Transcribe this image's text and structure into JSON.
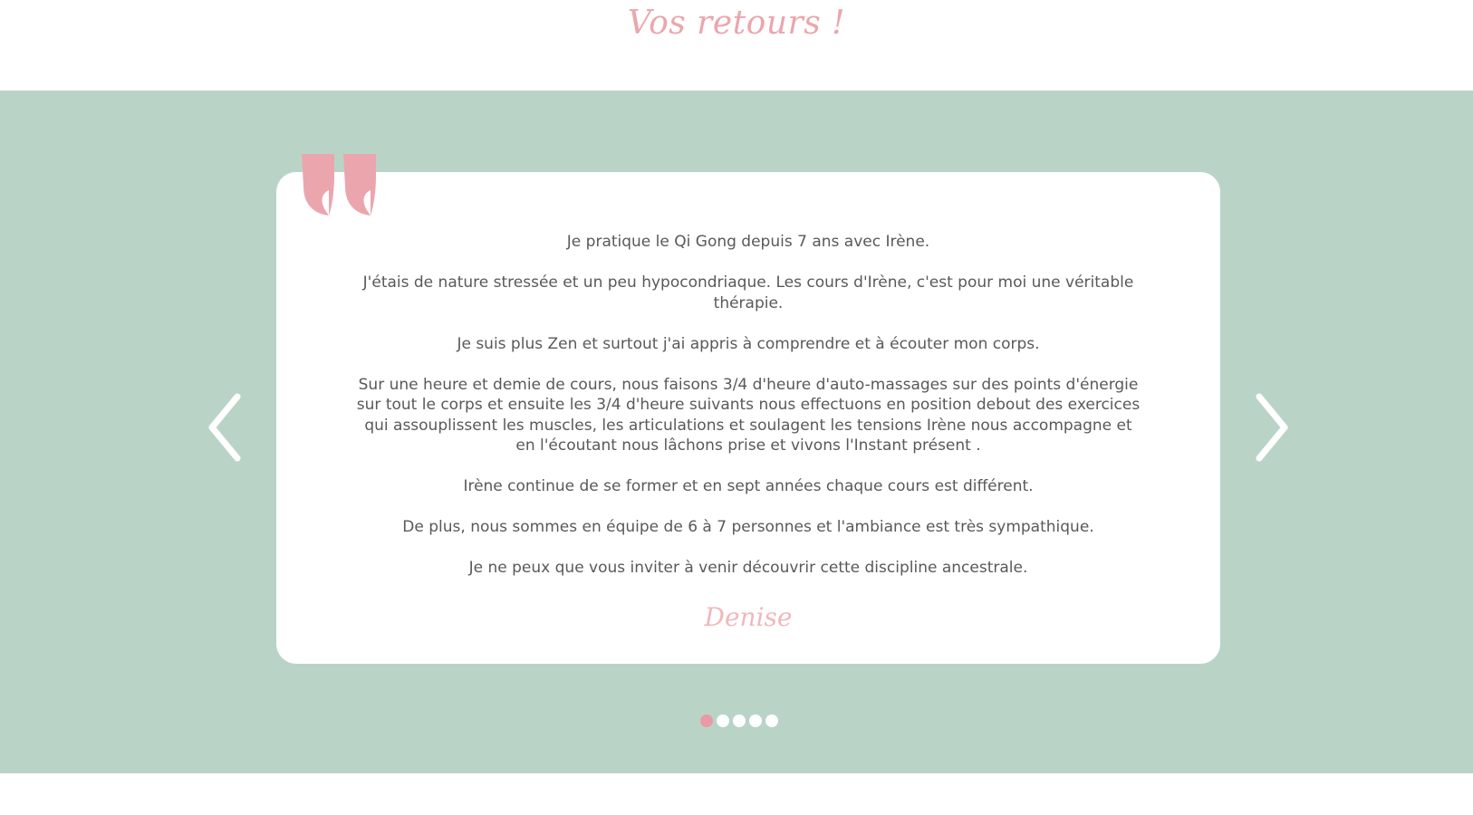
{
  "heading": "Vos retours !",
  "testimonial": {
    "paragraphs": [
      "Je pratique le Qi Gong depuis 7 ans avec Irène.",
      "J'étais de nature stressée et un peu hypocondriaque. Les cours d'Irène, c'est pour moi une véritable thérapie.",
      "Je suis plus Zen et surtout j'ai appris à comprendre et à écouter mon corps.",
      "Sur une heure et demie de cours, nous faisons 3/4 d'heure d'auto-massages sur des points d'énergie sur tout le corps et ensuite les 3/4 d'heure suivants nous effectuons en position debout des exercices qui assouplissent les muscles, les articulations et soulagent les tensions Irène nous accompagne et en l'écoutant nous lâchons prise et vivons l'Instant présent .",
      "Irène continue de se former et en sept années chaque cours est différent.",
      "De plus, nous sommes en équipe de 6 à 7 personnes et l'ambiance est très sympathique.",
      "Je ne peux que vous inviter à venir découvrir cette discipline ancestrale."
    ],
    "author": "Denise"
  },
  "icons": {
    "quote": "quote-mark-icon",
    "prev": "chevron-left-icon",
    "next": "chevron-right-icon"
  },
  "pagination": {
    "count": 5,
    "active_index": 0
  },
  "colors": {
    "band": "#b9d4c6",
    "accent_pink": "#eba6ad",
    "dot_active": "#e99aa4",
    "text": "#595959",
    "card": "#ffffff"
  }
}
